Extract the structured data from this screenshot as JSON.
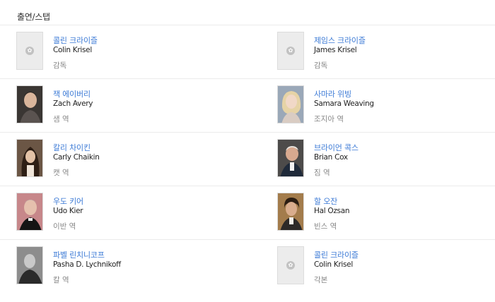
{
  "section": {
    "title": "출연/스탭"
  },
  "people": [
    {
      "name_ko": "콜린 크라이즐",
      "name_en": "Colin Krisel",
      "role": "감독",
      "photo": "placeholder"
    },
    {
      "name_ko": "제임스 크라이즐",
      "name_en": "James Krisel",
      "role": "감독",
      "photo": "placeholder"
    },
    {
      "name_ko": "잭 에이버리",
      "name_en": "Zach Avery",
      "role": "샘 역",
      "photo": "portrait"
    },
    {
      "name_ko": "사마라 위빙",
      "name_en": "Samara Weaving",
      "role": "조지아 역",
      "photo": "portrait"
    },
    {
      "name_ko": "칼리 차이킨",
      "name_en": "Carly Chaikin",
      "role": "캣 역",
      "photo": "portrait"
    },
    {
      "name_ko": "브라이언 콕스",
      "name_en": "Brian Cox",
      "role": "짐 역",
      "photo": "portrait"
    },
    {
      "name_ko": "우도 키어",
      "name_en": "Udo Kier",
      "role": "이반 역",
      "photo": "portrait"
    },
    {
      "name_ko": "할 오잔",
      "name_en": "Hal Ozsan",
      "role": "빈스 역",
      "photo": "portrait"
    },
    {
      "name_ko": "파벨 린치니코프",
      "name_en": "Pasha D. Lychnikoff",
      "role": "칼 역",
      "photo": "portrait"
    },
    {
      "name_ko": "콜린 크라이즐",
      "name_en": "Colin Krisel",
      "role": "각본",
      "photo": "placeholder"
    }
  ],
  "colors": {
    "link": "#3d7bd6",
    "text": "#222222",
    "muted": "#888888",
    "divider": "#ebebeb"
  }
}
